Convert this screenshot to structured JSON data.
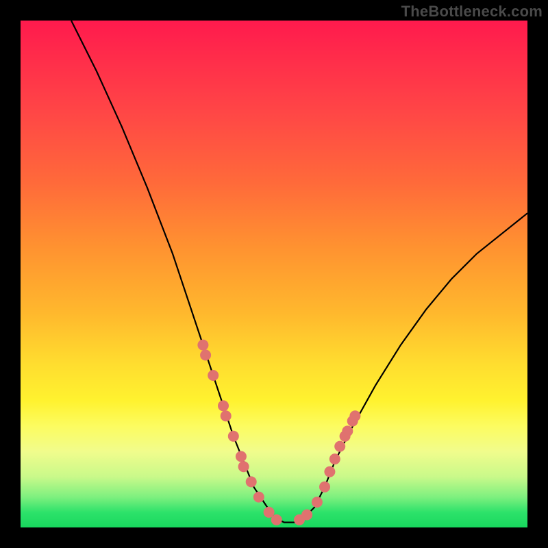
{
  "watermark": "TheBottleneck.com",
  "chart_data": {
    "type": "line",
    "title": "",
    "xlabel": "",
    "ylabel": "",
    "xlim": [
      0,
      100
    ],
    "ylim": [
      0,
      100
    ],
    "grid": false,
    "legend": false,
    "series": [
      {
        "name": "curve",
        "color": "#000000",
        "x": [
          10,
          15,
          20,
          25,
          30,
          33,
          36,
          38,
          40,
          42,
          44,
          46,
          48,
          50,
          52,
          54,
          56,
          58,
          60,
          62,
          65,
          70,
          75,
          80,
          85,
          90,
          95,
          100
        ],
        "y": [
          100,
          90,
          79,
          67,
          54,
          45,
          36,
          30,
          24,
          18,
          13,
          8,
          5,
          2,
          1,
          1,
          2,
          4,
          8,
          13,
          19,
          28,
          36,
          43,
          49,
          54,
          58,
          62
        ]
      }
    ],
    "markers_left": [
      {
        "x": 36,
        "y": 36
      },
      {
        "x": 36.5,
        "y": 34
      },
      {
        "x": 38,
        "y": 30
      },
      {
        "x": 40,
        "y": 24
      },
      {
        "x": 40.5,
        "y": 22
      },
      {
        "x": 42,
        "y": 18
      },
      {
        "x": 43.5,
        "y": 14
      },
      {
        "x": 44,
        "y": 12
      },
      {
        "x": 45.5,
        "y": 9
      },
      {
        "x": 47,
        "y": 6
      },
      {
        "x": 49,
        "y": 3
      },
      {
        "x": 50.5,
        "y": 1.5
      }
    ],
    "markers_right": [
      {
        "x": 55,
        "y": 1.5
      },
      {
        "x": 56.5,
        "y": 2.5
      },
      {
        "x": 58.5,
        "y": 5
      },
      {
        "x": 60,
        "y": 8
      },
      {
        "x": 61,
        "y": 11
      },
      {
        "x": 62,
        "y": 13.5
      },
      {
        "x": 63,
        "y": 16
      },
      {
        "x": 64,
        "y": 18
      },
      {
        "x": 64.5,
        "y": 19
      },
      {
        "x": 65.5,
        "y": 21
      },
      {
        "x": 66,
        "y": 22
      }
    ],
    "marker_color": "#e0726f",
    "marker_radius": 8
  }
}
